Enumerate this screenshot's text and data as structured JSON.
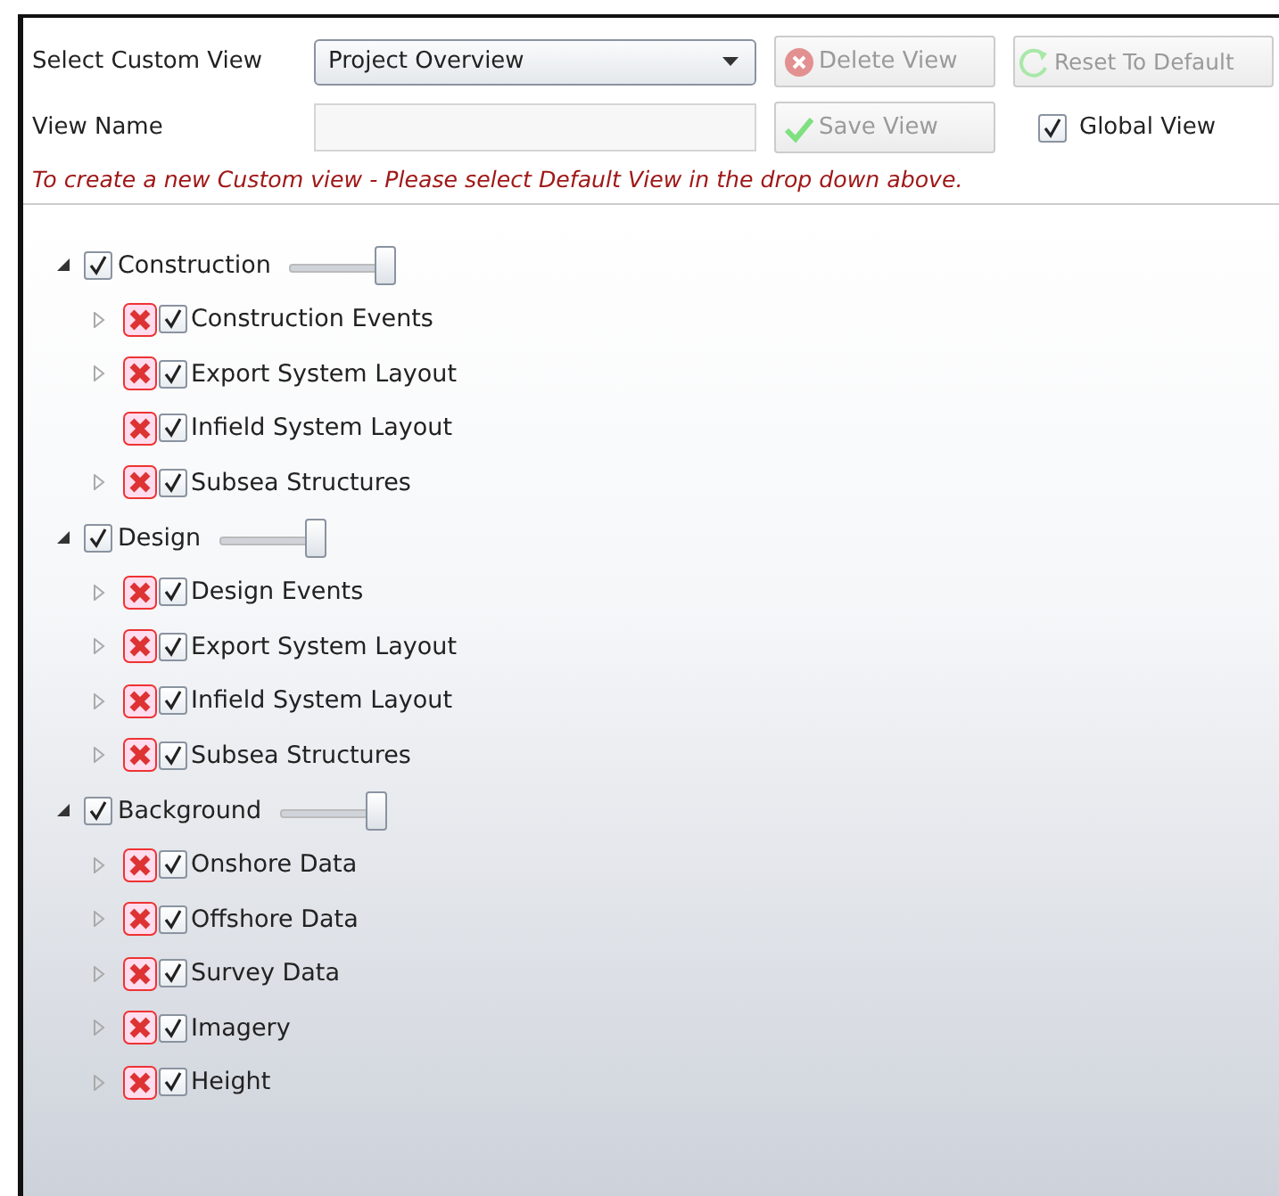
{
  "header": {
    "select_label": "Select Custom View",
    "select_value": "Project Overview",
    "delete_button": {
      "label": "Delete View",
      "disabled": true
    },
    "reset_button": {
      "label": "Reset To Default",
      "disabled": true
    },
    "name_label": "View Name",
    "save_button": {
      "label": "Save View",
      "disabled": true
    },
    "global_view": {
      "label": "Global View",
      "checked": true
    },
    "hint": "To create a new Custom view - Please select Default View in the drop down above."
  },
  "tree": [
    {
      "label": "Construction",
      "checked": true,
      "expanded": true,
      "level": 1,
      "children": [
        {
          "label": "Construction Events",
          "checked": true,
          "has_children": true
        },
        {
          "label": "Export System Layout",
          "checked": true,
          "has_children": true
        },
        {
          "label": "Infield System Layout",
          "checked": true,
          "has_children": false
        },
        {
          "label": "Subsea Structures",
          "checked": true,
          "has_children": true
        }
      ]
    },
    {
      "label": "Design",
      "checked": true,
      "expanded": true,
      "level": 1,
      "children": [
        {
          "label": "Design Events",
          "checked": true,
          "has_children": true
        },
        {
          "label": "Export System Layout",
          "checked": true,
          "has_children": true
        },
        {
          "label": "Infield System Layout",
          "checked": true,
          "has_children": true
        },
        {
          "label": "Subsea Structures",
          "checked": true,
          "has_children": true
        }
      ]
    },
    {
      "label": "Background",
      "checked": true,
      "expanded": true,
      "level": 1,
      "children": [
        {
          "label": "Onshore Data",
          "checked": true,
          "has_children": true
        },
        {
          "label": "Offshore Data",
          "checked": true,
          "has_children": true
        },
        {
          "label": "Survey Data",
          "checked": true,
          "has_children": true
        },
        {
          "label": "Imagery",
          "checked": true,
          "has_children": true
        },
        {
          "label": "Height",
          "checked": true,
          "has_children": true
        }
      ]
    }
  ]
}
